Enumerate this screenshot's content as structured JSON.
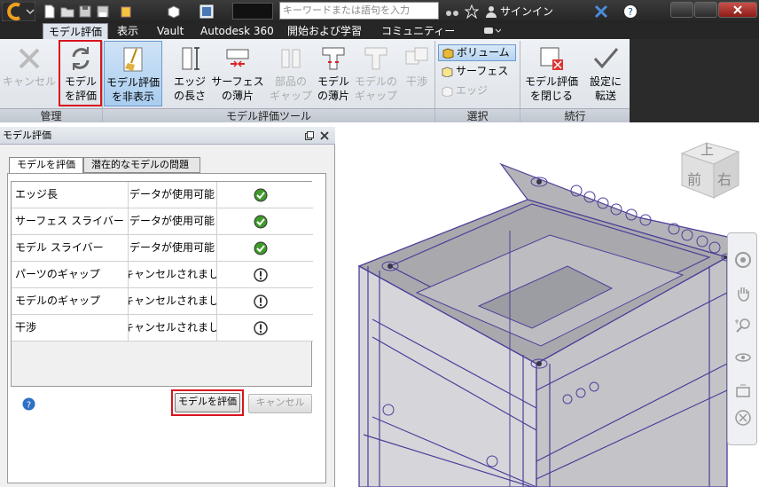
{
  "quick_access": {
    "search_placeholder": "キーワードまたは語句を入力",
    "signin_label": "サインイン"
  },
  "tabs": [
    "モデル評価",
    "表示",
    "Vault",
    "Autodesk 360",
    "開始および学習",
    "コミュニティー"
  ],
  "ribbon": {
    "cancel_label": "キャンセル",
    "evaluate_model_label": [
      "モデル",
      "を評価"
    ],
    "hide_eval_label": [
      "モデル評価",
      "を非表示"
    ],
    "edge_length_label": [
      "エッジ",
      "の長さ"
    ],
    "surface_sliver_label": [
      "サーフェス",
      "の薄片"
    ],
    "part_gap_label": [
      "部品の",
      "ギャップ"
    ],
    "model_sliver_label": [
      "モデル",
      "の薄片"
    ],
    "model_gap_label": [
      "モデルの",
      "ギャップ"
    ],
    "interference_label": "干渉",
    "volume_label": "ボリューム",
    "surface_label": "サーフェス",
    "edge_label": "エッジ",
    "close_eval_label": [
      "モデル評価",
      "を閉じる"
    ],
    "transfer_settings_label": [
      "設定に",
      "転送"
    ],
    "panels": {
      "manage": "管理",
      "tools": "モデル評価ツール",
      "select": "選択",
      "continue": "続行"
    }
  },
  "panel": {
    "title": "モデル評価",
    "tabs": [
      "モデルを評価",
      "潜在的なモデルの問題"
    ],
    "rows": [
      {
        "name": "エッジ長",
        "status": "データが使用可能",
        "state": "ok"
      },
      {
        "name": "サーフェス スライバー",
        "status": "データが使用可能",
        "state": "ok"
      },
      {
        "name": "モデル スライバー",
        "status": "データが使用可能",
        "state": "ok"
      },
      {
        "name": "パーツのギャップ",
        "status": "キャンセルされました",
        "state": "warn"
      },
      {
        "name": "モデルのギャップ",
        "status": "キャンセルされました",
        "state": "warn"
      },
      {
        "name": "干渉",
        "status": "キャンセルされました",
        "state": "warn"
      }
    ],
    "evaluate_button": "モデルを評価",
    "cancel_button": "キャンセル"
  },
  "viewcube": {
    "top": "上",
    "front": "前",
    "right": "右"
  },
  "colors": {
    "ok": "#3f9a2b",
    "highlight": "#d8131e",
    "model_edge": "#4b3f9a"
  }
}
